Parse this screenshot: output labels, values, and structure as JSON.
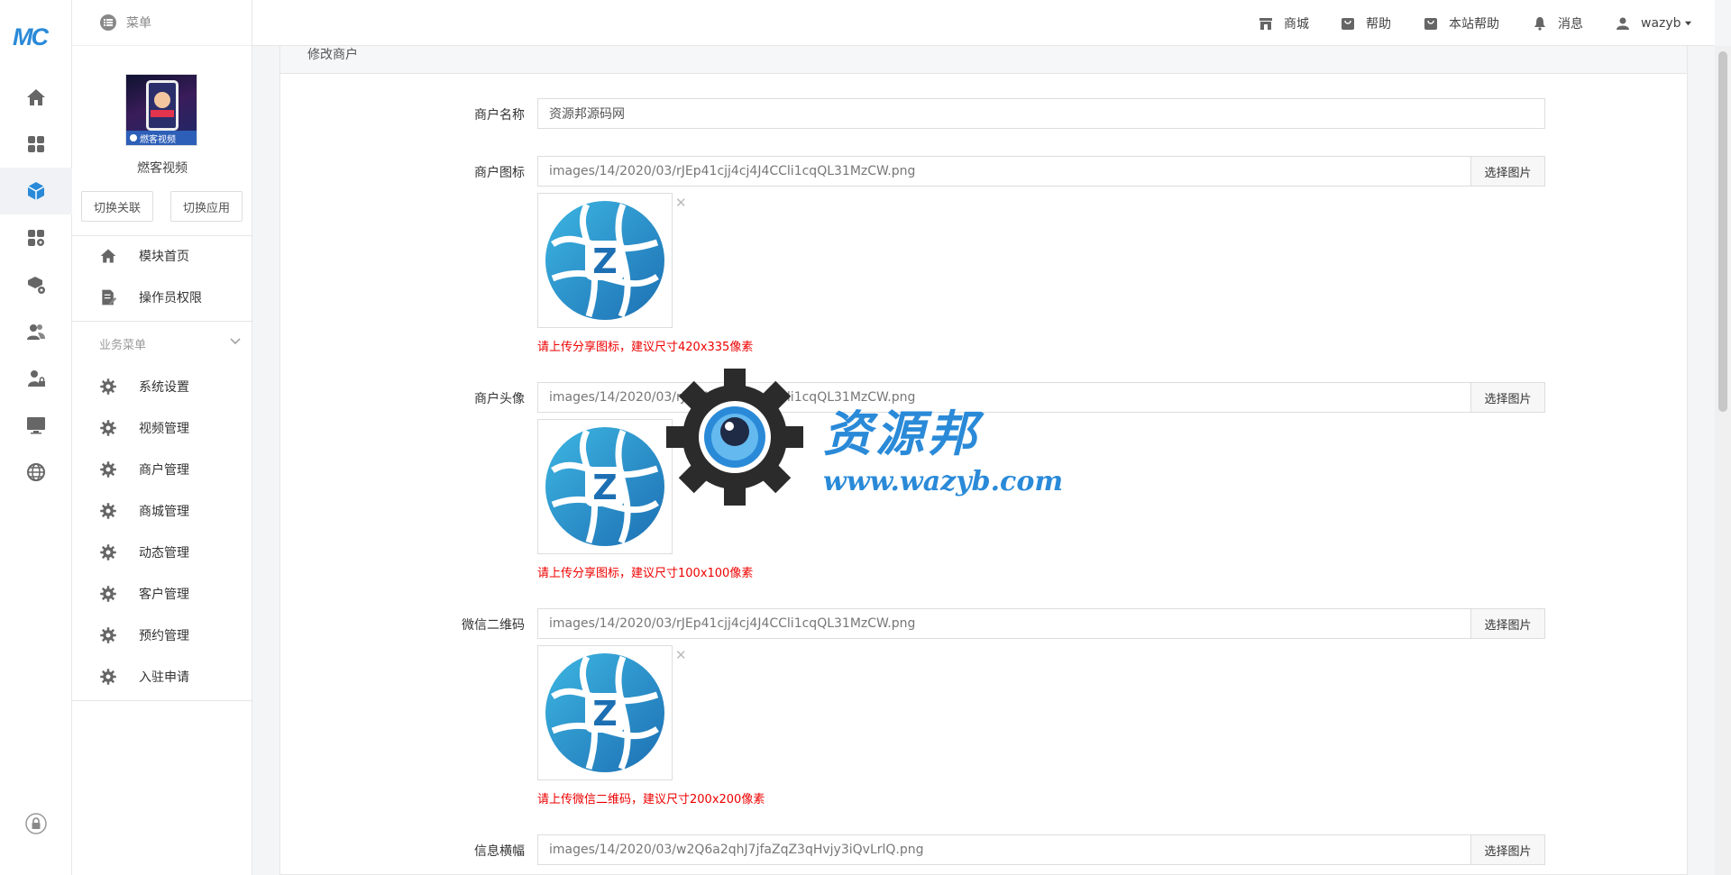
{
  "logo": "MC",
  "header": {
    "menu_label": "菜单",
    "items": [
      {
        "label": "商城",
        "icon": "store-icon"
      },
      {
        "label": "帮助",
        "icon": "help-bag-icon"
      },
      {
        "label": "本站帮助",
        "icon": "site-help-bag-icon"
      },
      {
        "label": "消息",
        "icon": "bell-icon"
      }
    ],
    "user": "wazyb"
  },
  "sidebar": {
    "app_thumb_text": "燃客视频",
    "app_name": "燃客视频",
    "switch_link": "切换关联",
    "switch_app": "切换应用",
    "top_items": [
      {
        "label": "模块首页",
        "icon": "home-icon"
      },
      {
        "label": "操作员权限",
        "icon": "document-edit-icon"
      }
    ],
    "group_title": "业务菜单",
    "group_items": [
      {
        "label": "系统设置"
      },
      {
        "label": "视频管理"
      },
      {
        "label": "商户管理"
      },
      {
        "label": "商城管理"
      },
      {
        "label": "动态管理"
      },
      {
        "label": "客户管理"
      },
      {
        "label": "预约管理"
      },
      {
        "label": "入驻申请"
      }
    ]
  },
  "form": {
    "panel_title": "修改商户",
    "name": {
      "label": "商户名称",
      "value": "资源邦源码网"
    },
    "icon": {
      "label": "商户图标",
      "value": "images/14/2020/03/rJEp41cjj4cj4J4CCli1cqQL31MzCW.png",
      "button": "选择图片",
      "hint": "请上传分享图标，建议尺寸420x335像素"
    },
    "avatar": {
      "label": "商户头像",
      "value": "images/14/2020/03/rJEp41cjj4cj4J4CCli1cqQL31MzCW.png",
      "button": "选择图片",
      "hint": "请上传分享图标，建议尺寸100x100像素"
    },
    "qrcode": {
      "label": "微信二维码",
      "value": "images/14/2020/03/rJEp41cjj4cj4J4CCli1cqQL31MzCW.png",
      "button": "选择图片",
      "hint": "请上传微信二维码，建议尺寸200x200像素"
    },
    "banner": {
      "label": "信息横幅",
      "value": "images/14/2020/03/w2Q6a2qhJ7jfaZqZ3qHvjy3iQvLrlQ.png",
      "button": "选择图片"
    }
  },
  "watermark": {
    "title": "资源邦",
    "url": "www.wazyb.com"
  },
  "colors": {
    "accent": "#2a8ad8",
    "hint": "#ee0000",
    "icon": "#555555"
  }
}
